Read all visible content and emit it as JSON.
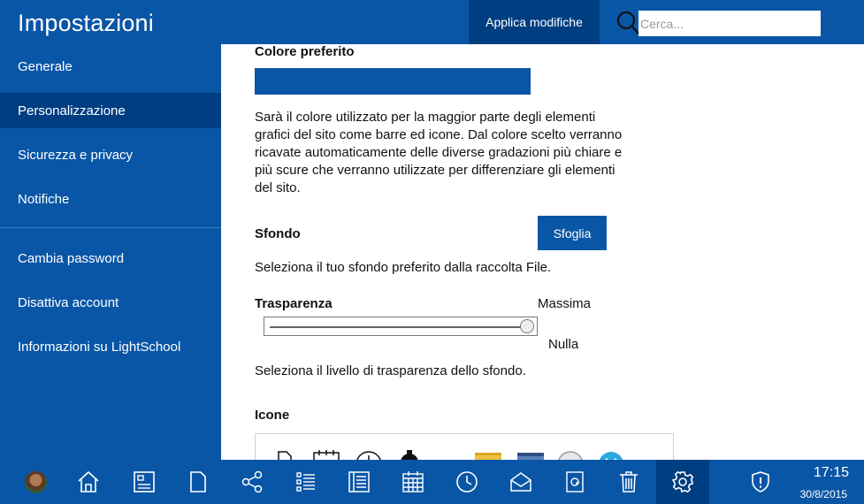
{
  "header": {
    "title": "Impostazioni",
    "apply_label": "Applica modifiche",
    "search_placeholder": "Cerca..."
  },
  "sidebar": {
    "items": [
      {
        "label": "Generale"
      },
      {
        "label": "Personalizzazione",
        "active": true
      },
      {
        "label": "Sicurezza e privacy"
      },
      {
        "label": "Notifiche"
      },
      {
        "label": "Cambia password"
      },
      {
        "label": "Disattiva account"
      },
      {
        "label": "Informazioni su LightSchool"
      }
    ]
  },
  "main": {
    "favorite_color": {
      "title": "Colore preferito",
      "value": "#0a56a6",
      "description_lines": [
        "Sarà il colore utilizzato per la maggior parte degli elementi",
        "grafici del sito come barre ed icone. Dal colore scelto verranno",
        "ricavate automaticamente delle diverse gradazioni più chiare e",
        "più scure che verranno utilizzate per differenziare gli elementi",
        "del sito."
      ]
    },
    "background": {
      "title": "Sfondo",
      "browse_label": "Sfoglia",
      "description": "Seleziona il tuo sfondo preferito dalla raccolta File."
    },
    "transparency": {
      "title": "Trasparenza",
      "max_label": "Massima",
      "min_label": "Nulla",
      "value_fraction": 1.0,
      "description": "Seleziona il livello di trasparenza dello sfondo."
    },
    "icons": {
      "title": "Icone"
    }
  },
  "taskbar": {
    "items": [
      "avatar",
      "home-icon",
      "desktop-icon",
      "file-icon",
      "share-icon",
      "list-icon",
      "notebook-icon",
      "calendar-icon",
      "clock-icon",
      "mail-icon",
      "contacts-icon",
      "trash-icon",
      "settings-icon",
      "shield-icon"
    ],
    "active": "settings-icon",
    "time": "17:15",
    "date": "30/8/2015"
  },
  "colors": {
    "accent": "#0a56a6",
    "accent_dark": "#003e82"
  }
}
